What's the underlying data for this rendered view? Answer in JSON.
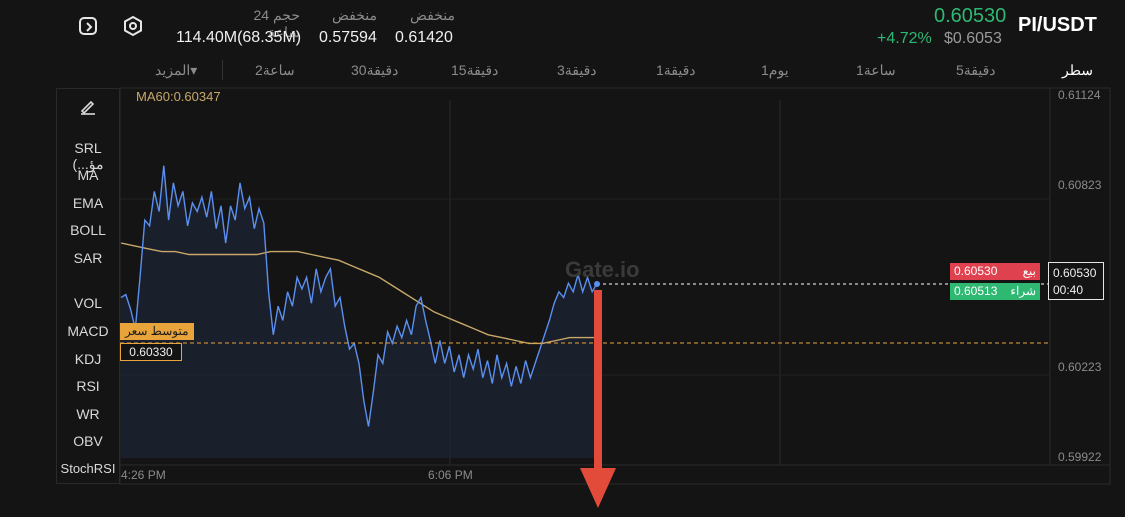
{
  "header": {
    "pair": "PI/USDT",
    "last_price": "0.60530",
    "change_pct": "+4.72%",
    "usd_price": "$0.6053",
    "stats": [
      {
        "label": "حجم 24 ساعة",
        "value": "114.40M(68.35M)"
      },
      {
        "label": "منخفض",
        "value": "0.57594"
      },
      {
        "label": "منخفض",
        "value": "0.61420"
      }
    ]
  },
  "timeframes": [
    {
      "label": "سطر",
      "active": true
    },
    {
      "label": "5دقيقة"
    },
    {
      "label": "1ساعة"
    },
    {
      "label": "1يوم"
    },
    {
      "label": "1دقيقة"
    },
    {
      "label": "3دقيقة"
    },
    {
      "label": "15دقيقة"
    },
    {
      "label": "30دقيقة"
    },
    {
      "label": "2ساعة"
    },
    {
      "label": "المزيد▾"
    }
  ],
  "indicators": [
    "SRL (...مؤ",
    "MA",
    "EMA",
    "BOLL",
    "SAR",
    "VOL",
    "MACD",
    "KDJ",
    "RSI",
    "WR",
    "OBV",
    "StochRSI"
  ],
  "chart": {
    "ma_label": "MA60:0.60347",
    "y_ticks": [
      "0.61124",
      "0.60823",
      "0.60223",
      "0.59922"
    ],
    "x_ticks": [
      "4:26 PM",
      "6:06 PM"
    ],
    "avg_label": "متوسط سعر",
    "avg_value": "0.60330",
    "current_price": "0.60530",
    "countdown": "00:40",
    "sell_label": "بيع",
    "sell_value": "0.60530",
    "buy_label": "شراء",
    "buy_value": "0.60513",
    "watermark": "Gate.io",
    "colors": {
      "line": "#5b8ff0",
      "ma": "#c8a86a",
      "avg": "#e8a33a",
      "sell": "#e0414f",
      "buy": "#2eb872",
      "arrow": "#e24a3a"
    }
  },
  "chart_data": {
    "type": "line",
    "x_ticks": [
      "4:26 PM",
      "6:06 PM"
    ],
    "ylim": [
      0.5992,
      0.6119
    ],
    "series": [
      {
        "name": "",
        "values": [
          0.6048,
          0.6049,
          0.6044,
          0.6037,
          0.6055,
          0.6075,
          0.6073,
          0.6085,
          0.6078,
          0.6094,
          0.6075,
          0.6088,
          0.608,
          0.6085,
          0.6073,
          0.6081,
          0.6078,
          0.6083,
          0.6076,
          0.6085,
          0.6072,
          0.608,
          0.6067,
          0.608,
          0.6075,
          0.6088,
          0.6079,
          0.6083,
          0.6072,
          0.6079,
          0.6074,
          0.605,
          0.6035,
          0.6045,
          0.604,
          0.605,
          0.6045,
          0.6055,
          0.6051,
          0.6055,
          0.6046,
          0.6058,
          0.605,
          0.6055,
          0.6058,
          0.6045,
          0.6048,
          0.6038,
          0.603,
          0.6032,
          0.6025,
          0.6012,
          0.6003,
          0.6015,
          0.6028,
          0.6025,
          0.6036,
          0.6032,
          0.6038,
          0.6034,
          0.604,
          0.6035,
          0.6045,
          0.6048,
          0.604,
          0.6033,
          0.6025,
          0.6033,
          0.6025,
          0.6031,
          0.6022,
          0.6028,
          0.602,
          0.6028,
          0.6023,
          0.603,
          0.602,
          0.6026,
          0.6018,
          0.6028,
          0.602,
          0.6025,
          0.6017,
          0.6024,
          0.6018,
          0.6026,
          0.602,
          0.6025,
          0.603,
          0.6035,
          0.604,
          0.6046,
          0.605,
          0.6048,
          0.6053,
          0.605,
          0.6056,
          0.605,
          0.6055,
          0.605,
          0.6053
        ]
      },
      {
        "name": "MA60",
        "values": [
          0.6067,
          0.6066,
          0.6065,
          0.6064,
          0.6064,
          0.6063,
          0.6063,
          0.6063,
          0.6063,
          0.6063,
          0.6063,
          0.6064,
          0.6064,
          0.6064,
          0.6063,
          0.6062,
          0.6061,
          0.6059,
          0.6057,
          0.6055,
          0.6052,
          0.6049,
          0.6046,
          0.6043,
          0.6041,
          0.6039,
          0.6037,
          0.6035,
          0.6034,
          0.6033,
          0.6032,
          0.6032,
          0.6033,
          0.6034,
          0.6034,
          0.6034
        ]
      }
    ]
  }
}
